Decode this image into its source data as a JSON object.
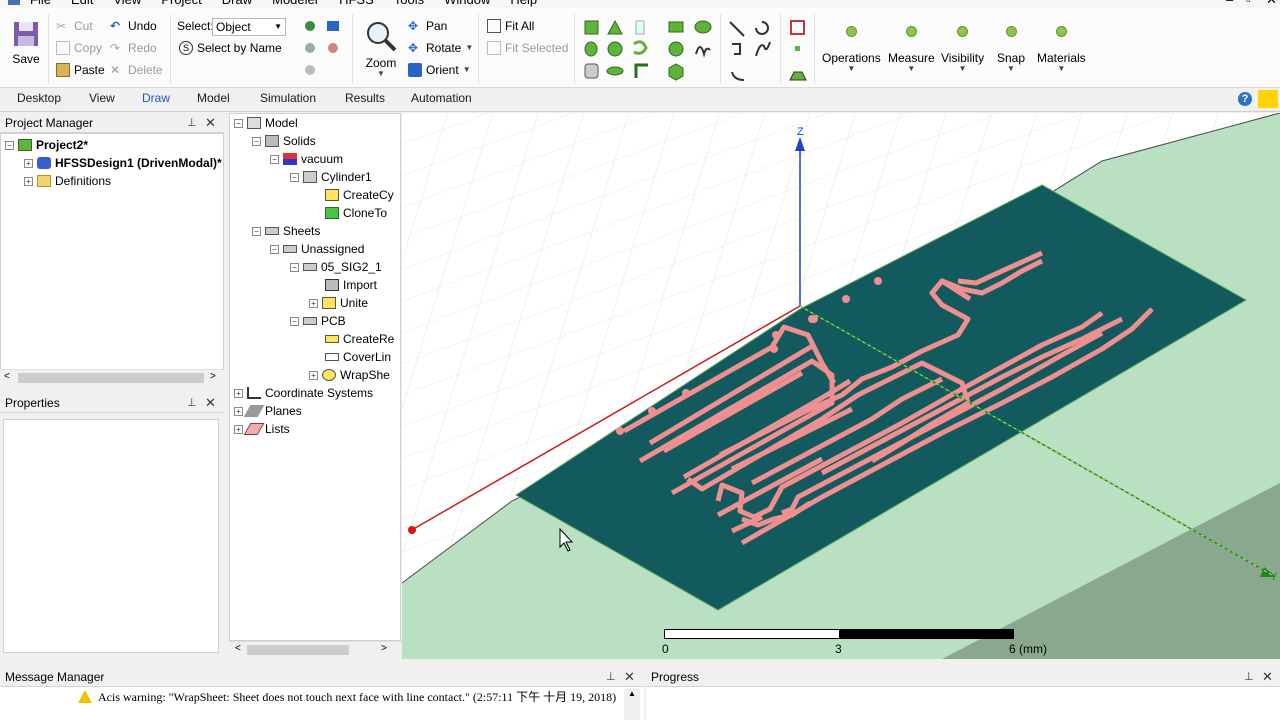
{
  "menu": {
    "items": [
      "File",
      "Edit",
      "View",
      "Project",
      "Draw",
      "Modeler",
      "HFSS",
      "Tools",
      "Window",
      "Help"
    ]
  },
  "ribbon": {
    "save": "Save",
    "cut": "Cut",
    "copy": "Copy",
    "paste": "Paste",
    "undo": "Undo",
    "redo": "Redo",
    "delete": "Delete",
    "select_label": "Select:",
    "select_value": "Object",
    "select_by_name": "Select by Name",
    "zoom": "Zoom",
    "pan": "Pan",
    "rotate": "Rotate",
    "orient": "Orient",
    "fit_all": "Fit All",
    "fit_selected": "Fit Selected",
    "operations": "Operations",
    "measure": "Measure",
    "visibility": "Visibility",
    "snap": "Snap",
    "materials": "Materials"
  },
  "tabs": [
    "Desktop",
    "View",
    "Draw",
    "Model",
    "Simulation",
    "Results",
    "Automation"
  ],
  "active_tab": "Draw",
  "project_manager": {
    "title": "Project Manager",
    "project": "Project2*",
    "design": "HFSSDesign1 (DrivenModal)*",
    "definitions": "Definitions"
  },
  "properties": {
    "title": "Properties"
  },
  "model_tree": {
    "model": "Model",
    "solids": "Solids",
    "vacuum": "vacuum",
    "cylinder1": "Cylinder1",
    "create_cy": "CreateCy",
    "clone_to": "CloneTo",
    "sheets": "Sheets",
    "unassigned": "Unassigned",
    "sig": "05_SIG2_1",
    "import": "Import",
    "unite": "Unite",
    "pcb": "PCB",
    "create_re": "CreateRe",
    "cover_lin": "CoverLin",
    "wrap_she": "WrapShe",
    "coord_systems": "Coordinate Systems",
    "planes": "Planes",
    "lists": "Lists"
  },
  "viewport": {
    "axis_z": "Z",
    "axis_y": "Y",
    "scale_0": "0",
    "scale_3": "3",
    "scale_6": "6 (mm)"
  },
  "message_manager": {
    "title": "Message Manager",
    "warning": "Acis warning: \"WrapSheet: Sheet does not touch next face with line contact.\" (2:57:11 下午  十月 19, 2018)"
  },
  "progress": {
    "title": "Progress"
  },
  "colors": {
    "board": "#135a5e",
    "trace": "#f08f8f",
    "cylinder": "#b7e1bf",
    "accent_tab": "#1a5bb5"
  }
}
